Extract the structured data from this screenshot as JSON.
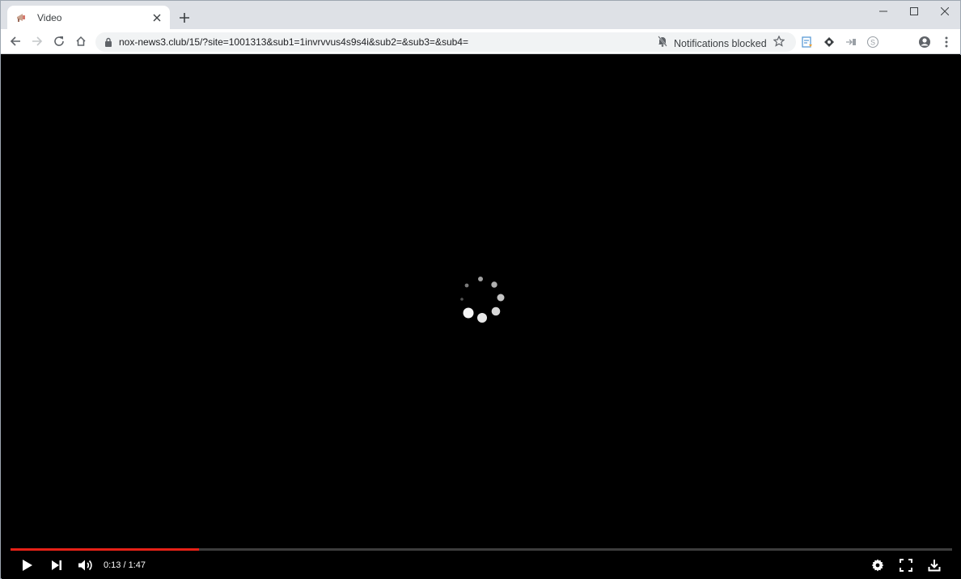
{
  "browser": {
    "tab": {
      "title": "Video",
      "favicon": "mic-megaphone-icon"
    },
    "window_controls": [
      "minimize-icon",
      "maximize-icon",
      "close-icon"
    ],
    "address_bar": {
      "url": "nox-news3.club/15/?site=1001313&sub1=1invrvvus4s9s4i&sub2=&sub3=&sub4=",
      "notification_status": "Notifications blocked"
    }
  },
  "player": {
    "progress_fraction": 0.2,
    "current_time": "0:13",
    "duration": "1:47",
    "time_text": "0:13 / 1:47",
    "colors": {
      "progress": "#e62117",
      "track": "#3d3d3d"
    }
  }
}
